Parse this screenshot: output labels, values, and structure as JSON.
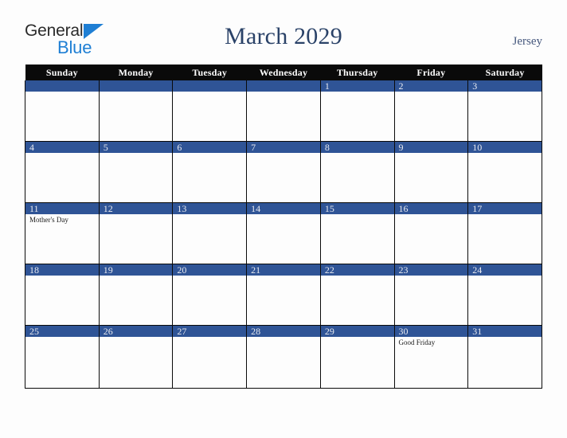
{
  "brand": {
    "name_part1": "General",
    "name_part2": "Blue",
    "triangle_icon": "triangle-icon",
    "color_dark": "#2b2b2b",
    "color_blue": "#1f7fd4"
  },
  "header": {
    "title": "March 2029",
    "locale": "Jersey",
    "title_color": "#2a4268"
  },
  "calendar": {
    "accent_color": "#2f5496",
    "header_bg": "#0a0a0a",
    "weekday_headers": [
      "Sunday",
      "Monday",
      "Tuesday",
      "Wednesday",
      "Thursday",
      "Friday",
      "Saturday"
    ],
    "weeks": [
      [
        {
          "day": "",
          "events": []
        },
        {
          "day": "",
          "events": []
        },
        {
          "day": "",
          "events": []
        },
        {
          "day": "",
          "events": []
        },
        {
          "day": "1",
          "events": []
        },
        {
          "day": "2",
          "events": []
        },
        {
          "day": "3",
          "events": []
        }
      ],
      [
        {
          "day": "4",
          "events": []
        },
        {
          "day": "5",
          "events": []
        },
        {
          "day": "6",
          "events": []
        },
        {
          "day": "7",
          "events": []
        },
        {
          "day": "8",
          "events": []
        },
        {
          "day": "9",
          "events": []
        },
        {
          "day": "10",
          "events": []
        }
      ],
      [
        {
          "day": "11",
          "events": [
            "Mother's Day"
          ]
        },
        {
          "day": "12",
          "events": []
        },
        {
          "day": "13",
          "events": []
        },
        {
          "day": "14",
          "events": []
        },
        {
          "day": "15",
          "events": []
        },
        {
          "day": "16",
          "events": []
        },
        {
          "day": "17",
          "events": []
        }
      ],
      [
        {
          "day": "18",
          "events": []
        },
        {
          "day": "19",
          "events": []
        },
        {
          "day": "20",
          "events": []
        },
        {
          "day": "21",
          "events": []
        },
        {
          "day": "22",
          "events": []
        },
        {
          "day": "23",
          "events": []
        },
        {
          "day": "24",
          "events": []
        }
      ],
      [
        {
          "day": "25",
          "events": []
        },
        {
          "day": "26",
          "events": []
        },
        {
          "day": "27",
          "events": []
        },
        {
          "day": "28",
          "events": []
        },
        {
          "day": "29",
          "events": []
        },
        {
          "day": "30",
          "events": [
            "Good Friday"
          ]
        },
        {
          "day": "31",
          "events": []
        }
      ]
    ]
  }
}
